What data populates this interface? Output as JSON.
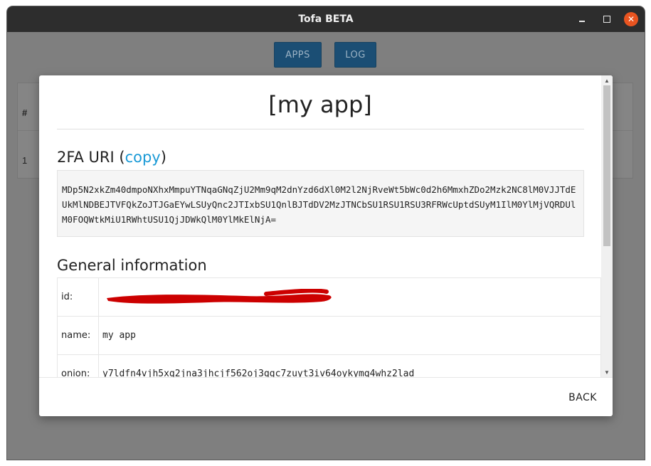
{
  "window": {
    "title": "Tofa BETA"
  },
  "toolbar": {
    "apps_label": "APPS",
    "log_label": "LOG"
  },
  "background_table": {
    "header_hash": "#",
    "row_index": "1"
  },
  "dialog": {
    "title": "[my app]",
    "uri_section": {
      "prefix": "2FA URI (",
      "copy_label": "copy",
      "suffix": ")"
    },
    "uri_value": "MDp5N2xkZm40dmpoNXhxMmpuYTNqaGNqZjU2Mm9qM2dnYzd6dXl0M2l2NjRveWt5bWc0d2h6MmxhZDo2Mzk2NC8lM0VJJTdEUkMlNDBEJTVFQkZoJTJGaEYwLSUyQnc2JTIxbSU1QnlBJTdDV2MzJTNCbSU1RSU1RSU3RFRWcUptdSUyM1IlM0YlMjVQRDUlM0FOQWtkMiU1RWhtUSU1QjJDWkQlM0YlMkElNjA=",
    "general_section_title": "General information",
    "info_rows": [
      {
        "key": "id:",
        "value": ""
      },
      {
        "key": "name:",
        "value": "my app"
      },
      {
        "key": "onion:",
        "value": "y7ldfn4vjh5xq2jna3jhcjf562oj3ggc7zuyt3iv64oykymg4whz2lad"
      }
    ],
    "back_label": "BACK"
  },
  "colors": {
    "accent": "#1a9ad6",
    "redaction": "#cc0000",
    "close": "#e95420",
    "topbar_button": "#1b4e74"
  }
}
